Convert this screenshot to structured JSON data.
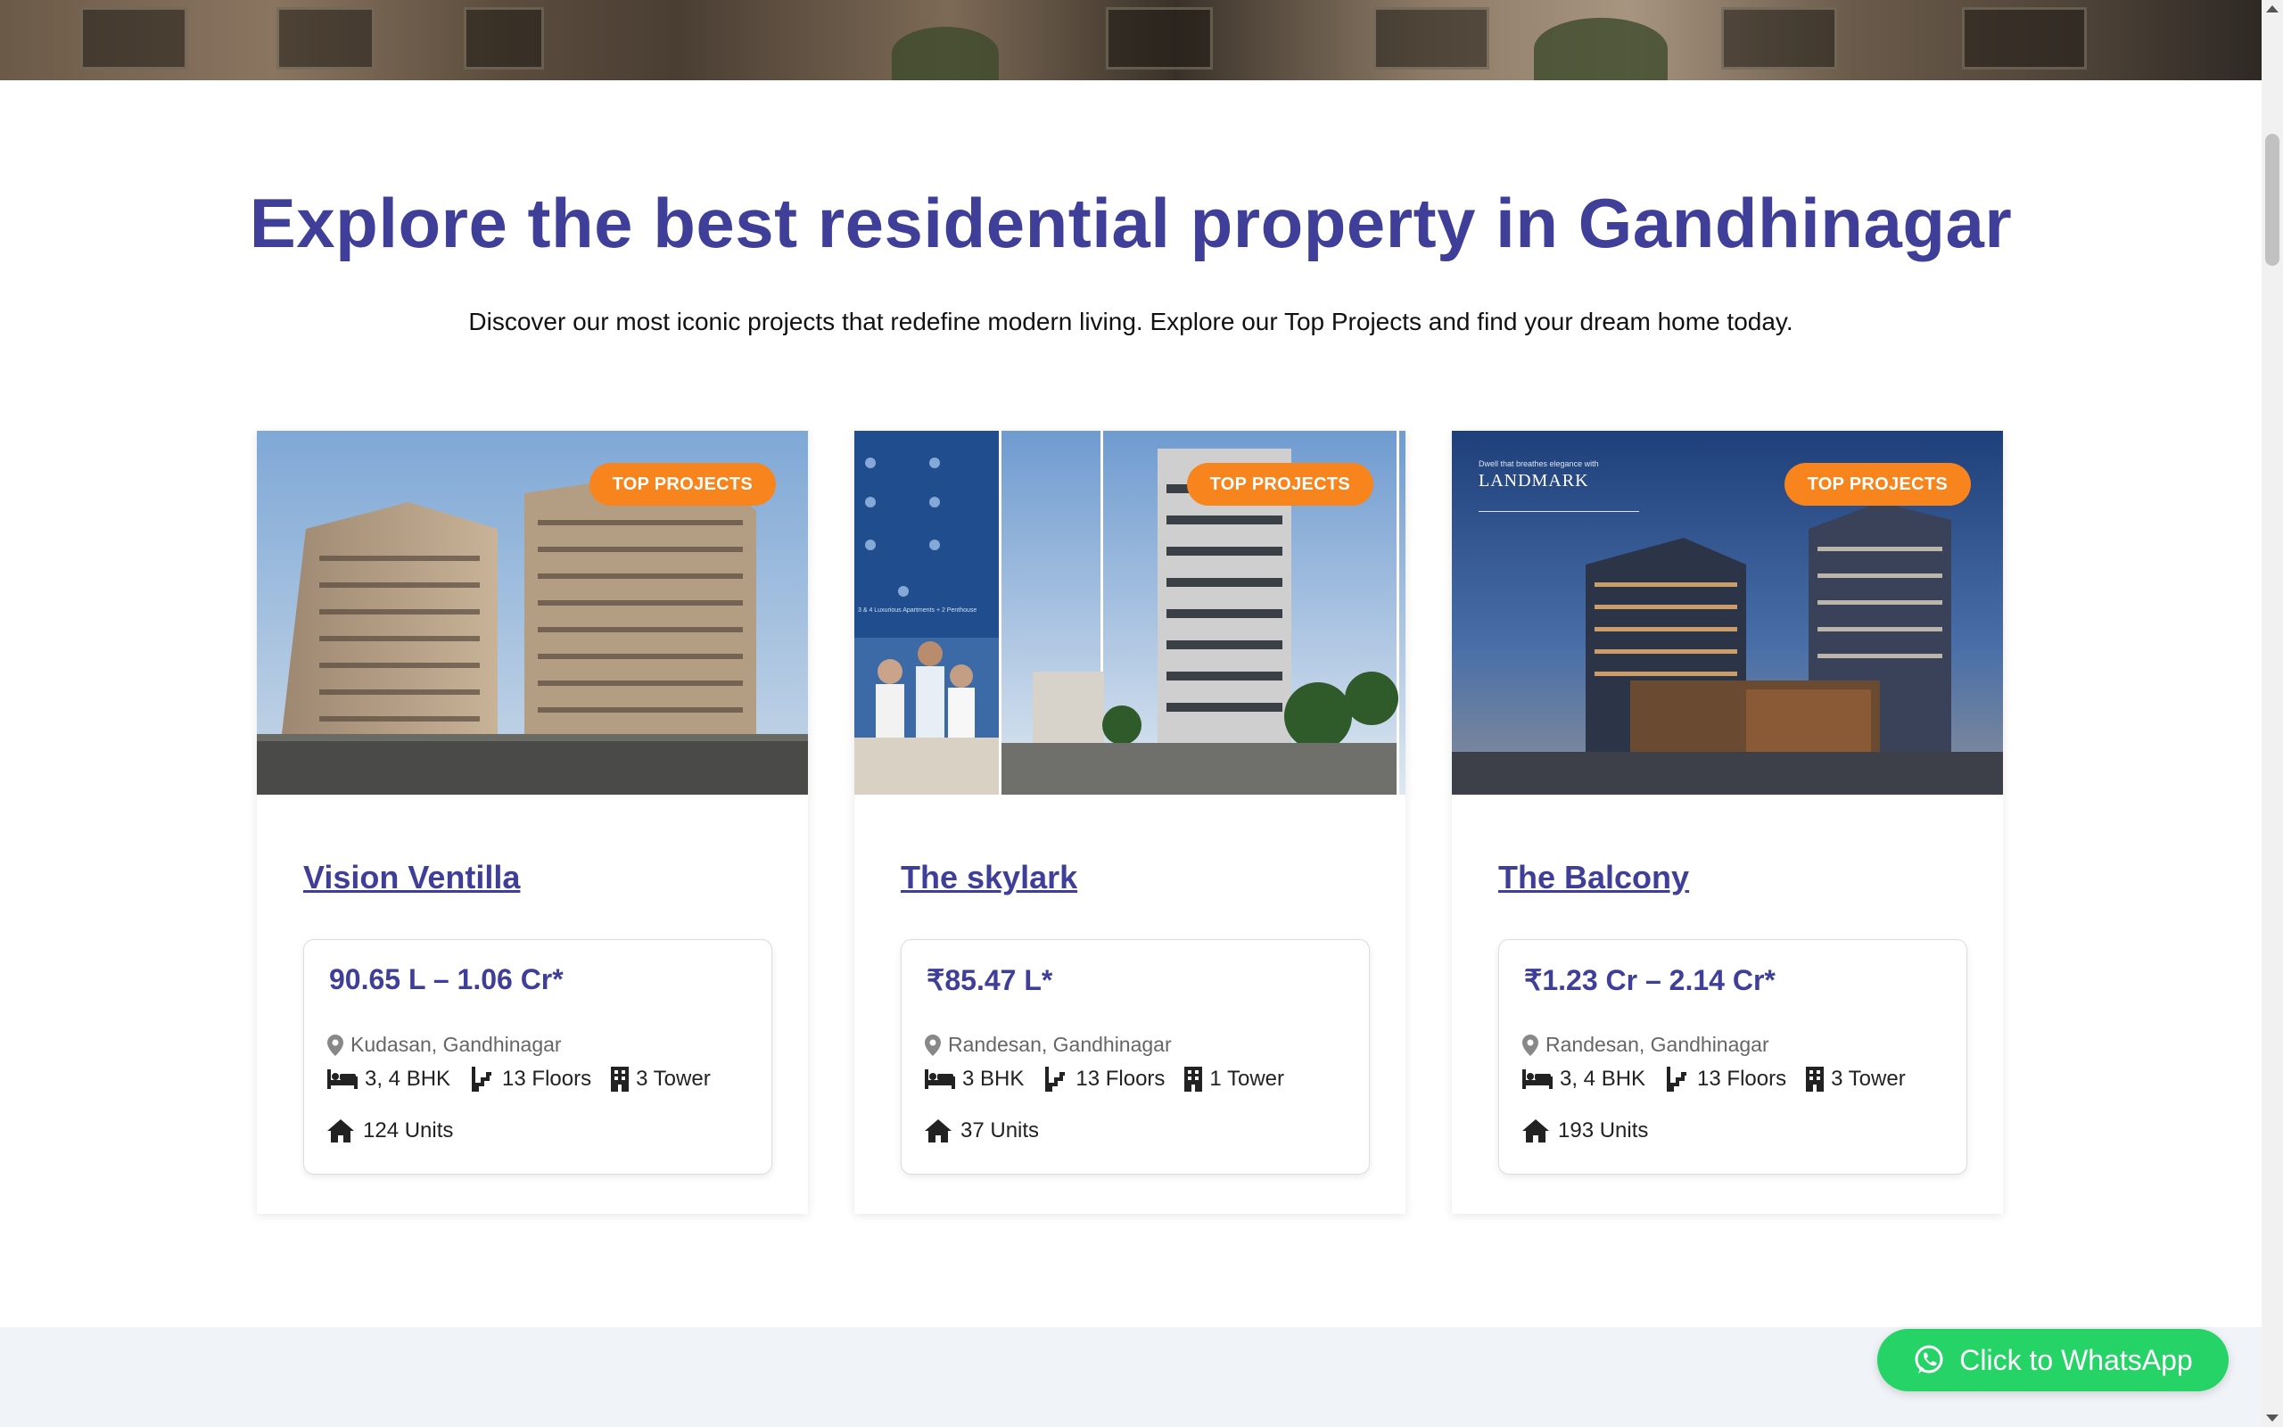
{
  "heading": "Explore the best residential property in Gandhinagar",
  "subheading": "Discover our most iconic projects that redefine modern living. Explore our Top Projects and find your dream home today.",
  "badge_label": "TOP PROJECTS",
  "cards": [
    {
      "title": "Vision Ventilla",
      "price": "90.65 L – 1.06 Cr*",
      "location": "Kudasan, Gandhinagar",
      "bhk": "3, 4 BHK",
      "floors": "13 Floors",
      "towers": "3 Tower",
      "units": "124 Units"
    },
    {
      "title": "The skylark",
      "price": "₹85.47 L*",
      "location": "Randesan, Gandhinagar",
      "bhk": "3 BHK",
      "floors": "13 Floors",
      "towers": "1 Tower",
      "units": "37 Units"
    },
    {
      "title": "The Balcony",
      "price": "₹1.23 Cr – 2.14 Cr*",
      "location": "Randesan, Gandhinagar",
      "bhk": "3, 4 BHK",
      "floors": "13 Floors",
      "towers": "3 Tower",
      "units": "193 Units"
    }
  ],
  "card3_banner": {
    "tagline": "Dwell that breathes elegance with",
    "brand": "LANDMARK"
  },
  "card2_banner_text": "3 & 4 Luxurious Apartments + 2 Penthouse",
  "whatsapp_label": "Click to WhatsApp",
  "colors": {
    "heading": "#3f3f99",
    "badge": "#f7841c",
    "whatsapp": "#25d366"
  }
}
